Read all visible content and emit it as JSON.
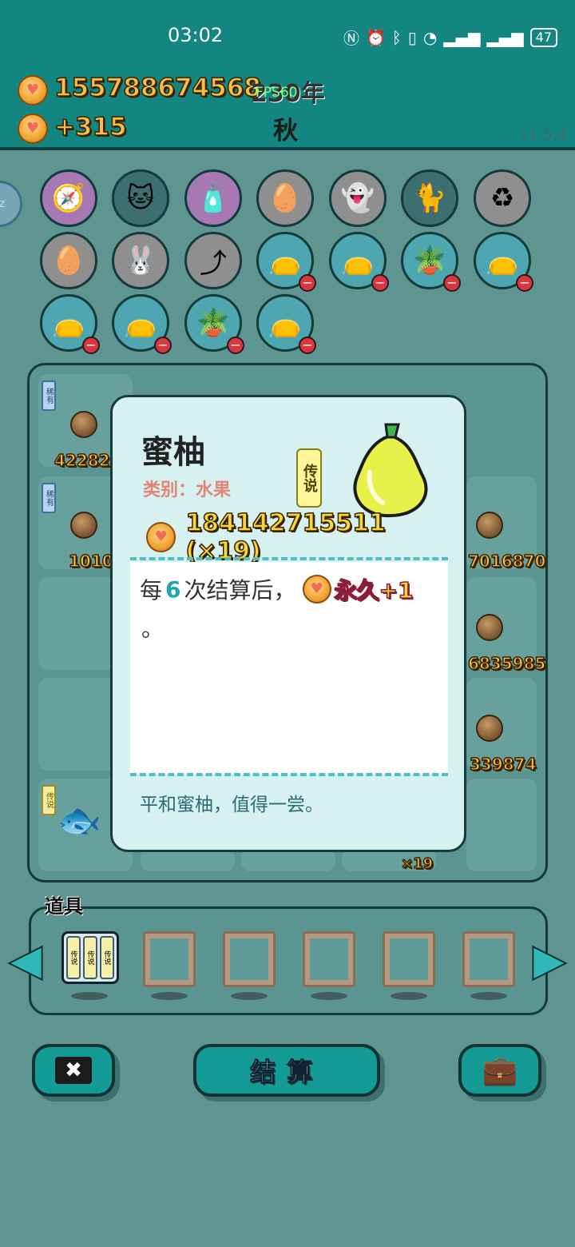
{
  "status_bar": {
    "time": "03:02",
    "icons": [
      "nfc-icon",
      "alarm-icon",
      "bluetooth-icon",
      "vibrate-icon",
      "wifi-icon",
      "signal-5g-icon",
      "signal-4g-icon"
    ],
    "battery": "47"
  },
  "header": {
    "money": "155788674568",
    "income": "+315",
    "year": "230年",
    "fps": "FPS60",
    "season": "秋",
    "version": "v1.5.4"
  },
  "board": {
    "tags": {
      "rare": "稀有",
      "legend": "传说"
    },
    "values": {
      "row1_left": "42282",
      "row2_left": "1010",
      "row2_right": "7016870",
      "row3_right": "6835985",
      "row4_right": "339874",
      "row5_count": "×19"
    }
  },
  "popup": {
    "title": "蜜柚",
    "category": "类别：水果",
    "rarity": "传说",
    "value": "184142715511 (×19)",
    "effect_prefix": "每",
    "effect_number": "6",
    "effect_mid": "次结算后，",
    "effect_bonus": "永久+1",
    "effect_end": "。",
    "flavor": "平和蜜柚，值得一尝。"
  },
  "items": {
    "label": "道具",
    "first_item_tags": [
      "传说",
      "传说",
      "传说"
    ]
  },
  "buttons": {
    "settle": "结算"
  },
  "colors": {
    "bg": "#5e9591",
    "header": "#148682",
    "accent_teal": "#149b96",
    "gold": "#f5c04a"
  }
}
